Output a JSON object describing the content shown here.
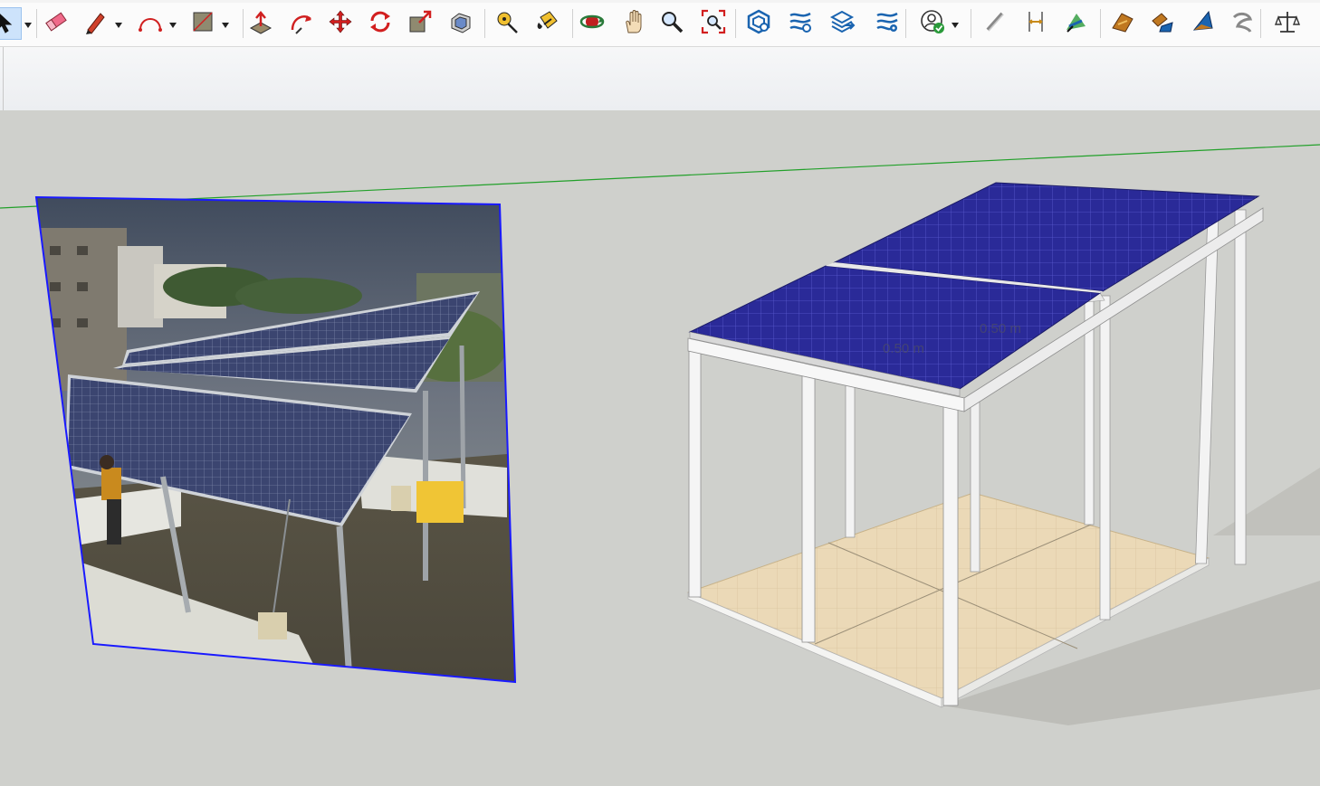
{
  "colors": {
    "toolbar_bg": "#fbfbfb",
    "viewport_bg": "#cfd0cc",
    "selection_blue": "#1a1aff",
    "axis_green": "#22a02a",
    "panel_blue": "#23238f",
    "frame_white": "#f2f2f2",
    "floor_tile": "#e8d6b3",
    "dimension_text": "#555555"
  },
  "toolbar": {
    "tools": [
      {
        "name": "select-tool",
        "icon": "arrow-cursor-icon",
        "active": true,
        "dropdown": true
      },
      {
        "name": "eraser-tool",
        "icon": "eraser-icon"
      },
      {
        "name": "line-tool",
        "icon": "pencil-icon",
        "dropdown": true
      },
      {
        "name": "arc-tool",
        "icon": "arc-icon",
        "dropdown": true
      },
      {
        "name": "shape-tool",
        "icon": "rectangle-icon",
        "dropdown": true
      },
      {
        "name": "push-pull-tool",
        "icon": "push-pull-icon"
      },
      {
        "name": "follow-me-tool",
        "icon": "follow-me-icon"
      },
      {
        "name": "move-tool",
        "icon": "move-icon"
      },
      {
        "name": "rotate-tool",
        "icon": "rotate-icon"
      },
      {
        "name": "scale-tool",
        "icon": "scale-icon"
      },
      {
        "name": "offset-tool",
        "icon": "offset-icon"
      },
      {
        "name": "tape-measure-tool",
        "icon": "tape-measure-icon"
      },
      {
        "name": "paint-bucket-tool",
        "icon": "paint-bucket-icon"
      },
      {
        "name": "orbit-tool",
        "icon": "orbit-icon"
      },
      {
        "name": "pan-tool",
        "icon": "hand-icon"
      },
      {
        "name": "zoom-tool",
        "icon": "magnifier-icon"
      },
      {
        "name": "zoom-extents-tool",
        "icon": "zoom-extents-icon"
      },
      {
        "name": "warehouse-tool",
        "icon": "3d-warehouse-icon"
      },
      {
        "name": "extension-warehouse-tool",
        "icon": "extension-warehouse-icon"
      },
      {
        "name": "share-model-tool",
        "icon": "share-model-icon"
      },
      {
        "name": "extension-manager-tool",
        "icon": "extension-manager-icon"
      },
      {
        "name": "account-tool",
        "icon": "account-icon",
        "dropdown": true
      },
      {
        "name": "section-plane-tool",
        "icon": "section-plane-icon"
      },
      {
        "name": "dimension-tool",
        "icon": "dimension-icon"
      },
      {
        "name": "protractor-tool",
        "icon": "protractor-icon"
      },
      {
        "name": "sandbox-tool",
        "icon": "sandbox-icon"
      },
      {
        "name": "stamp-tool",
        "icon": "stamp-icon"
      },
      {
        "name": "drape-tool",
        "icon": "drape-icon"
      },
      {
        "name": "smoove-tool",
        "icon": "smoove-icon"
      },
      {
        "name": "model-info-tool",
        "icon": "balance-scale-icon"
      }
    ]
  },
  "viewport": {
    "photo": {
      "description_icon": "image-icon",
      "selected": true
    },
    "model": {
      "panel_grid_cols": 5,
      "panel_grid_rows": 6,
      "dimension_labels": [
        "0.50 m",
        "0.50 m"
      ]
    }
  }
}
